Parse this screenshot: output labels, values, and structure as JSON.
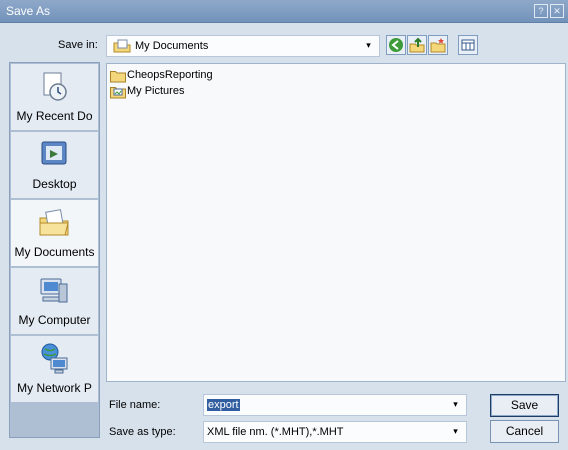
{
  "window": {
    "title": "Save As",
    "help_icon": "help-icon",
    "close_icon": "close-icon"
  },
  "toolbar": {
    "save_in_label": "Save in:",
    "save_in_value": "My Documents",
    "icons": [
      "back-icon",
      "up-folder-icon",
      "new-folder-icon",
      "view-menu-icon"
    ]
  },
  "places": [
    {
      "label": "My Recent Do",
      "icon": "recent-documents-icon"
    },
    {
      "label": "Desktop",
      "icon": "desktop-icon"
    },
    {
      "label": "My Documents",
      "icon": "my-documents-icon",
      "selected": true
    },
    {
      "label": "My Computer",
      "icon": "my-computer-icon"
    },
    {
      "label": "My Network P",
      "icon": "network-places-icon"
    }
  ],
  "files": [
    {
      "name": "CheopsReporting",
      "icon": "folder-icon"
    },
    {
      "name": "My Pictures",
      "icon": "pictures-folder-icon"
    }
  ],
  "form": {
    "file_name_label": "File name:",
    "file_name_value": "export",
    "save_type_label": "Save as type:",
    "save_type_value": "XML file nm. (*.MHT),*.MHT"
  },
  "buttons": {
    "save": "Save",
    "cancel": "Cancel"
  }
}
